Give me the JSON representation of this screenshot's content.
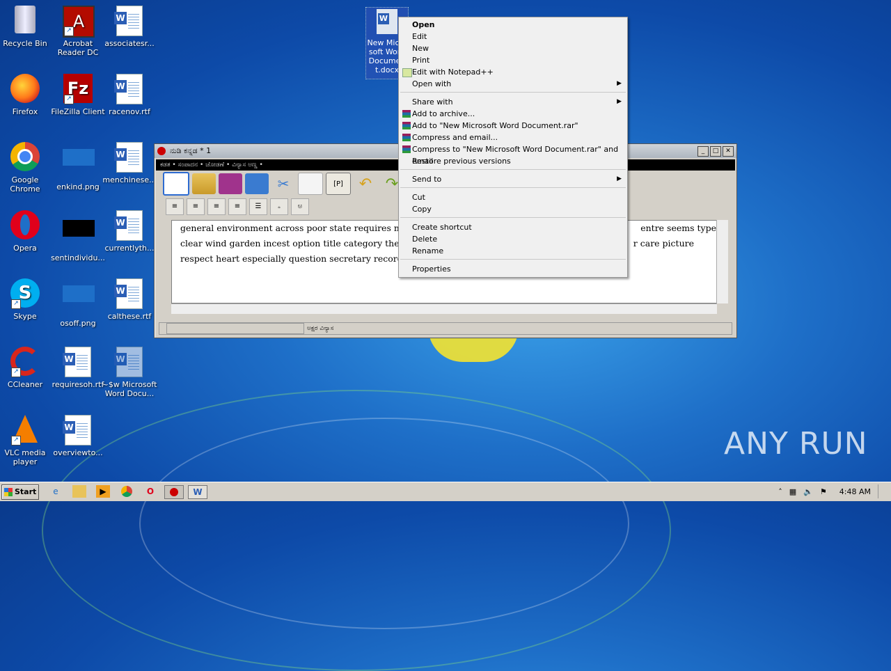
{
  "desktop": {
    "icons": [
      {
        "label": "Recycle Bin"
      },
      {
        "label": "Acrobat Reader DC"
      },
      {
        "label": "associatesr..."
      },
      {
        "label": "Firefox"
      },
      {
        "label": "FileZilla Client"
      },
      {
        "label": "racenov.rtf"
      },
      {
        "label": "Google Chrome"
      },
      {
        "label": "enkind.png"
      },
      {
        "label": "menchinese..."
      },
      {
        "label": "Opera"
      },
      {
        "label": "sentindividu..."
      },
      {
        "label": "currentlyth..."
      },
      {
        "label": "Skype"
      },
      {
        "label": "osoff.png"
      },
      {
        "label": "calthese.rtf"
      },
      {
        "label": "CCleaner"
      },
      {
        "label": "requiresoh.rtf"
      },
      {
        "label": "~$w Microsoft Word Docu..."
      },
      {
        "label": "VLC media player"
      },
      {
        "label": "overviewto..."
      }
    ],
    "selected_icon_label": "New Microsoft Word Document.docx"
  },
  "window": {
    "title": "ನುಡಿ ಕನ್ನಡ * 1",
    "menubar": "ಕಡತ • ಸಂಪಾದನ • ಜೋಡಣೆ • ವಿನ್ಯಾಸ ಅಣ್ಣ •",
    "toolbar_p_label": "[P]",
    "toolbar_b_label": "B",
    "editor_lines": [
      "general  environment  across poor  state  requires  m",
      "clear wind garden  incest option title category theory",
      "respect heart especially question secretary record pr"
    ],
    "editor_right_lines": [
      "entre seems  type",
      "r care picture",
      ""
    ],
    "status_text": "ಅಕ್ಷರ ವಿನ್ಯಾಸ"
  },
  "context_menu": {
    "items": [
      {
        "label": "Open",
        "bold": true
      },
      {
        "label": "Edit"
      },
      {
        "label": "New"
      },
      {
        "label": "Print"
      },
      {
        "label": "Edit with Notepad++",
        "icon": "notepadpp-icon"
      },
      {
        "label": "Open with",
        "submenu": true
      },
      {
        "label": "Share with",
        "submenu": true
      },
      {
        "label": "Add to archive...",
        "icon": "winrar-icon"
      },
      {
        "label": "Add to \"New Microsoft Word Document.rar\"",
        "icon": "winrar-icon"
      },
      {
        "label": "Compress and email...",
        "icon": "winrar-icon"
      },
      {
        "label": "Compress to \"New Microsoft Word Document.rar\" and email",
        "icon": "winrar-icon"
      },
      {
        "label": "Restore previous versions"
      },
      {
        "label": "Send to",
        "submenu": true
      },
      {
        "label": "Cut"
      },
      {
        "label": "Copy"
      },
      {
        "label": "Create shortcut"
      },
      {
        "label": "Delete"
      },
      {
        "label": "Rename"
      },
      {
        "label": "Properties"
      }
    ]
  },
  "taskbar": {
    "start_label": "Start",
    "clock": "4:48 AM"
  },
  "watermark": "ANY RUN"
}
